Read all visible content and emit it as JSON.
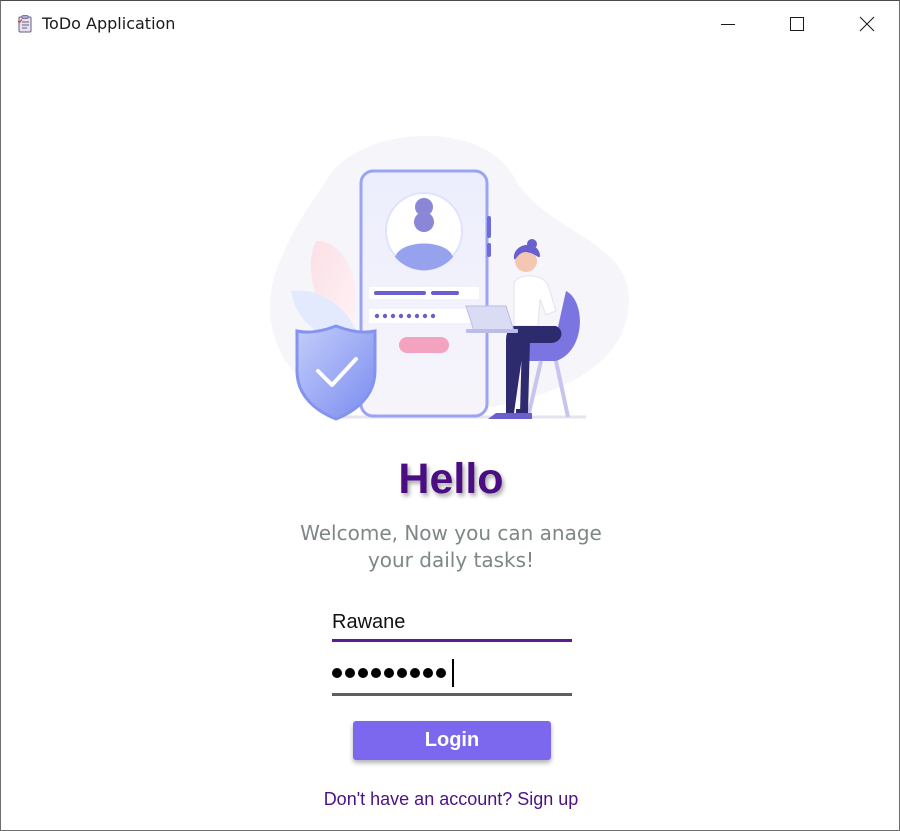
{
  "window": {
    "title": "ToDo Application",
    "controls": {
      "minimize": "minimize-icon",
      "maximize": "maximize-icon",
      "close": "close-icon"
    }
  },
  "hero": {
    "illustration": "login-illustration"
  },
  "greeting": {
    "title": "Hello",
    "subtitle_line1": "Welcome, Now you can anage",
    "subtitle_line2": "your daily tasks!"
  },
  "form": {
    "username_value": "Rawane",
    "password_length": 9,
    "login_label": "Login",
    "signup_text": "Don't have an account? Sign up"
  },
  "colors": {
    "accent": "#4a0d82",
    "button": "#7b68ee",
    "subtitle": "#7e8787"
  }
}
